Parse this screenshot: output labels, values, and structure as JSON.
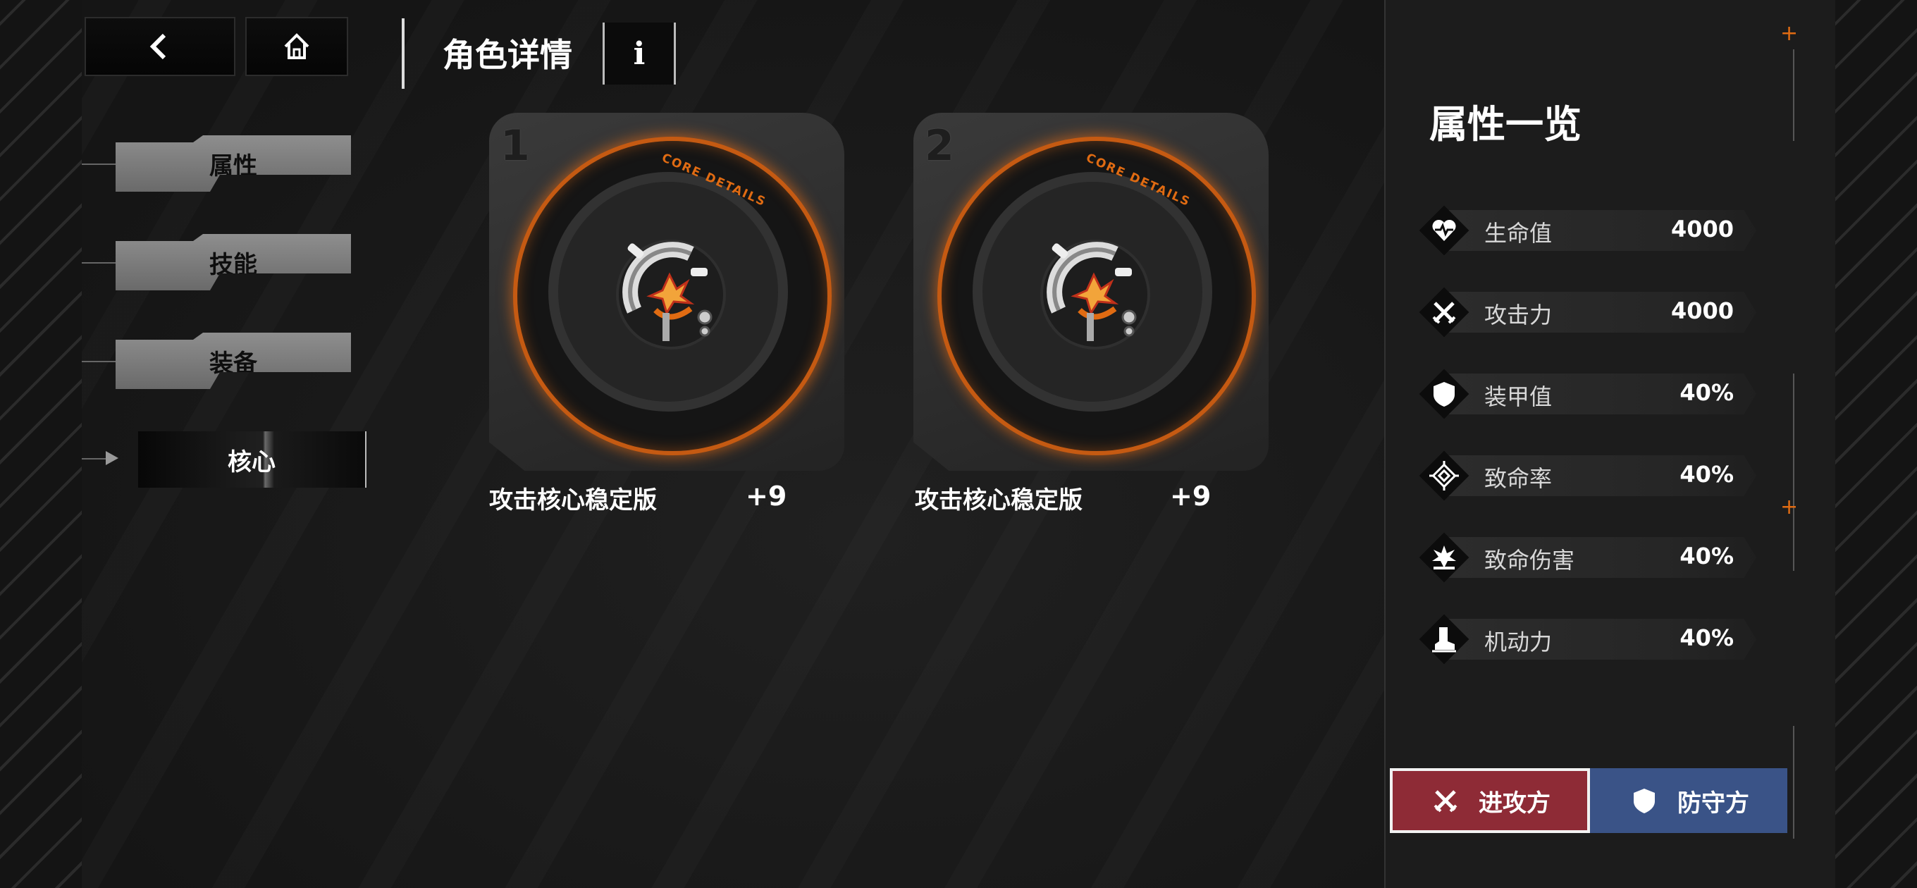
{
  "header": {
    "title": "角色详情",
    "info_label": "i"
  },
  "tabs": [
    {
      "label": "属性",
      "active": false
    },
    {
      "label": "技能",
      "active": false
    },
    {
      "label": "装备",
      "active": false
    },
    {
      "label": "核心",
      "active": true
    }
  ],
  "cores": [
    {
      "slot": "1",
      "badge": "CORE DETAILS",
      "name": "攻击核心稳定版",
      "level": "+9"
    },
    {
      "slot": "2",
      "badge": "CORE DETAILS",
      "name": "攻击核心稳定版",
      "level": "+9"
    }
  ],
  "panel": {
    "title": "属性一览",
    "stats": [
      {
        "label": "生命值",
        "value": "4000",
        "icon": "heart-icon"
      },
      {
        "label": "攻击力",
        "value": "4000",
        "icon": "crossed-swords-icon"
      },
      {
        "label": "装甲值",
        "value": "40%",
        "icon": "shield-icon"
      },
      {
        "label": "致命率",
        "value": "40%",
        "icon": "crosshair-icon"
      },
      {
        "label": "致命伤害",
        "value": "40%",
        "icon": "explosion-icon"
      },
      {
        "label": "机动力",
        "value": "40%",
        "icon": "boot-icon"
      }
    ],
    "attack_label": "进攻方",
    "defense_label": "防守方"
  },
  "colors": {
    "accent_orange": "#e06b12",
    "attack_red": "#8e2b36",
    "defense_blue": "#3a5387"
  }
}
